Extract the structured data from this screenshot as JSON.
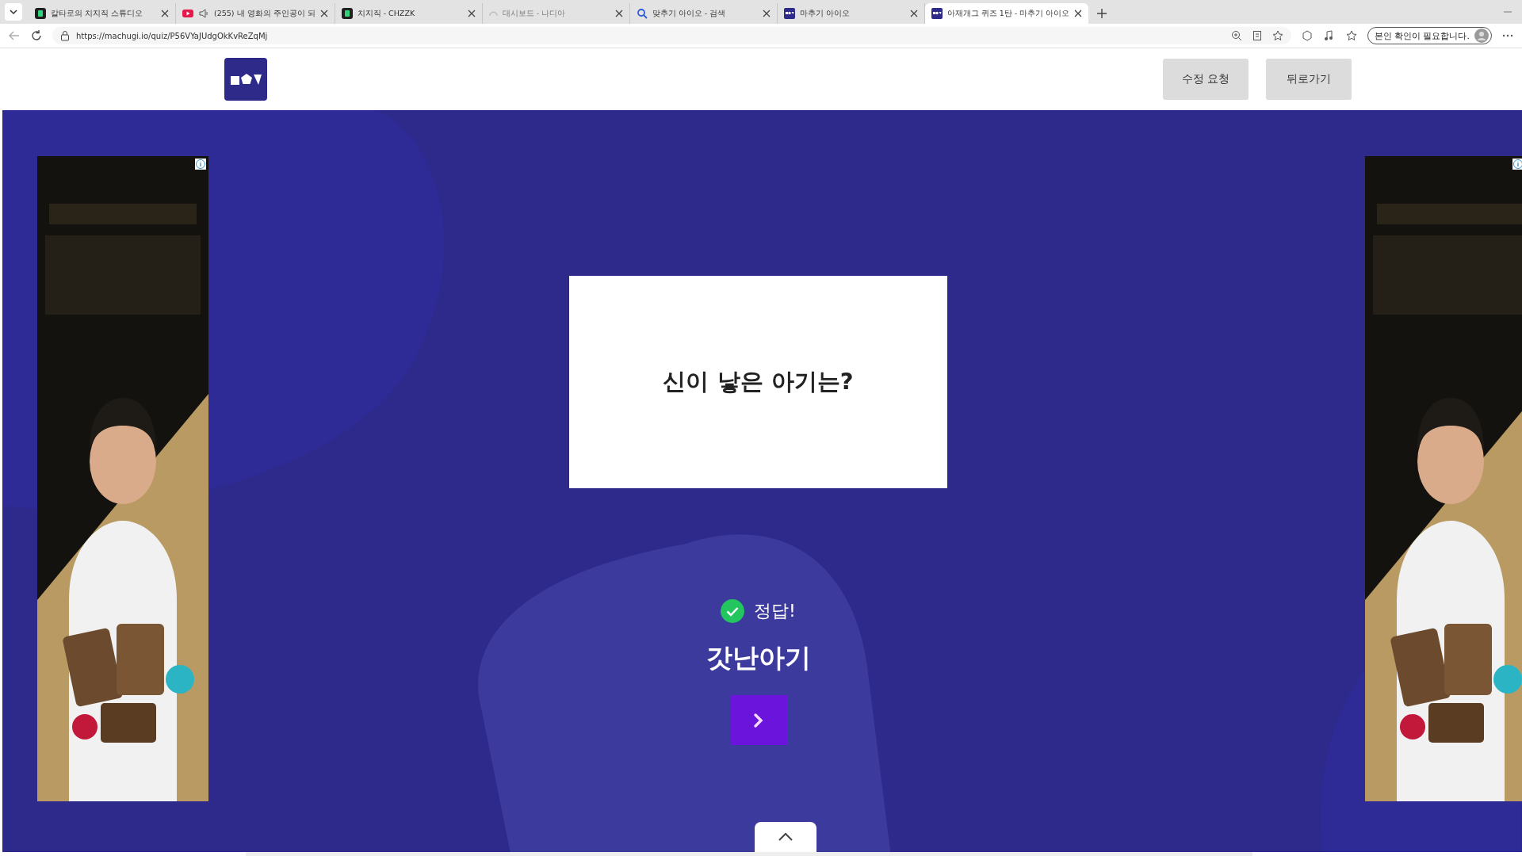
{
  "browser": {
    "tabs": [
      {
        "title": "칼타로의 치지직 스튜디오",
        "selected": false
      },
      {
        "title": "(255) 내 영화의 주인공이 되",
        "selected": false
      },
      {
        "title": "치지직 - CHZZK",
        "selected": false
      },
      {
        "title": "대시보드 - 나디아",
        "selected": false
      },
      {
        "title": "맞추기 아이오 - 검색",
        "selected": false
      },
      {
        "title": "마추기 아이오",
        "selected": false
      },
      {
        "title": "아재개그 퀴즈 1탄 - 마추기 아이오",
        "selected": true
      }
    ],
    "url": "https://machugi.io/quiz/P56VYaJUdgOkKvReZqMj",
    "profile": "본인 확인이 필요합니다."
  },
  "header": {
    "buttons": [
      "수정 요청",
      "뒤로가기"
    ]
  },
  "quiz": {
    "question": "신이 낳은 아기는?",
    "result": {
      "correct": true,
      "label": "정답!"
    },
    "answer": "갓난아기"
  }
}
